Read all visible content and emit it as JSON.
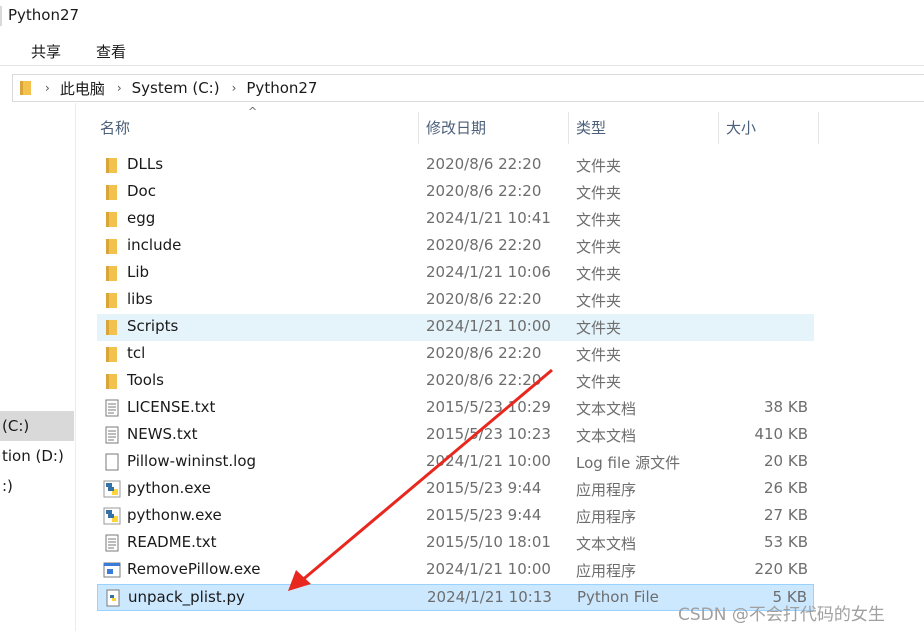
{
  "window": {
    "title": "Python27"
  },
  "ribbon": {
    "tabs": [
      "共享",
      "查看"
    ]
  },
  "address": {
    "crumbs": [
      "此电脑",
      "System (C:)",
      "Python27"
    ]
  },
  "nav": {
    "items": [
      "(C:)",
      "tion (D:)",
      ":)"
    ]
  },
  "columns": {
    "name": "名称",
    "date": "修改日期",
    "type": "类型",
    "size": "大小"
  },
  "files": [
    {
      "name": "DLLs",
      "date": "2020/8/6 22:20",
      "type": "文件夹",
      "size": "",
      "icon": "folder-icon"
    },
    {
      "name": "Doc",
      "date": "2020/8/6 22:20",
      "type": "文件夹",
      "size": "",
      "icon": "folder-icon"
    },
    {
      "name": "egg",
      "date": "2024/1/21 10:41",
      "type": "文件夹",
      "size": "",
      "icon": "folder-icon"
    },
    {
      "name": "include",
      "date": "2020/8/6 22:20",
      "type": "文件夹",
      "size": "",
      "icon": "folder-icon"
    },
    {
      "name": "Lib",
      "date": "2024/1/21 10:06",
      "type": "文件夹",
      "size": "",
      "icon": "folder-icon"
    },
    {
      "name": "libs",
      "date": "2020/8/6 22:20",
      "type": "文件夹",
      "size": "",
      "icon": "folder-icon"
    },
    {
      "name": "Scripts",
      "date": "2024/1/21 10:00",
      "type": "文件夹",
      "size": "",
      "icon": "folder-icon"
    },
    {
      "name": "tcl",
      "date": "2020/8/6 22:20",
      "type": "文件夹",
      "size": "",
      "icon": "folder-icon"
    },
    {
      "name": "Tools",
      "date": "2020/8/6 22:20",
      "type": "文件夹",
      "size": "",
      "icon": "folder-icon"
    },
    {
      "name": "LICENSE.txt",
      "date": "2015/5/23 10:29",
      "type": "文本文档",
      "size": "38 KB",
      "icon": "text-file-icon"
    },
    {
      "name": "NEWS.txt",
      "date": "2015/5/23 10:23",
      "type": "文本文档",
      "size": "410 KB",
      "icon": "text-file-icon"
    },
    {
      "name": "Pillow-wininst.log",
      "date": "2024/1/21 10:00",
      "type": "Log file 源文件",
      "size": "20 KB",
      "icon": "log-file-icon"
    },
    {
      "name": "python.exe",
      "date": "2015/5/23 9:44",
      "type": "应用程序",
      "size": "26 KB",
      "icon": "python-exe-icon"
    },
    {
      "name": "pythonw.exe",
      "date": "2015/5/23 9:44",
      "type": "应用程序",
      "size": "27 KB",
      "icon": "python-exe-icon"
    },
    {
      "name": "README.txt",
      "date": "2015/5/10 18:01",
      "type": "文本文档",
      "size": "53 KB",
      "icon": "text-file-icon"
    },
    {
      "name": "RemovePillow.exe",
      "date": "2024/1/21 10:00",
      "type": "应用程序",
      "size": "220 KB",
      "icon": "app-exe-icon"
    },
    {
      "name": "unpack_plist.py",
      "date": "2024/1/21 10:13",
      "type": "Python File",
      "size": "5 KB",
      "icon": "python-file-icon"
    }
  ],
  "watermark": "CSDN @不会打代码的女生",
  "colors": {
    "folder": "#f2c14e",
    "selection": "#cce8ff",
    "hover": "#e5f3fb",
    "arrow": "#e8271e"
  }
}
